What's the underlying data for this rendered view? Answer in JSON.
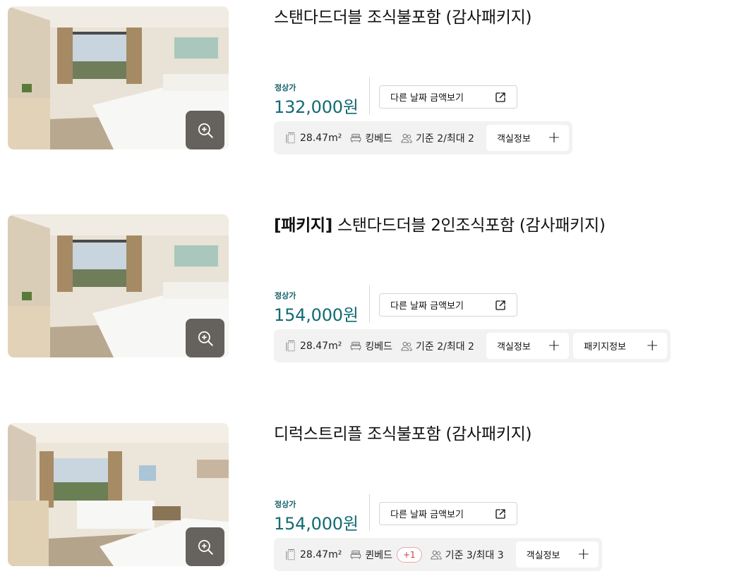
{
  "rooms": [
    {
      "title_tag": "",
      "title": "스탠다드더블 조식불포함 (감사패키지)",
      "price_label": "정상가",
      "price": "132,000원",
      "other_date_label": "다른 날짜 금액보기",
      "area": "28.47m²",
      "bed": "킹베드",
      "bed_badge": "",
      "occupancy": "기준 2/최대 2",
      "room_info_label": "객실정보",
      "package_info_label": ""
    },
    {
      "title_tag": "[패키지]",
      "title": " 스탠다드더블 2인조식포함 (감사패키지)",
      "price_label": "정상가",
      "price": "154,000원",
      "other_date_label": "다른 날짜 금액보기",
      "area": "28.47m²",
      "bed": "킹베드",
      "bed_badge": "",
      "occupancy": "기준 2/최대 2",
      "room_info_label": "객실정보",
      "package_info_label": "패키지정보"
    },
    {
      "title_tag": "",
      "title": "디럭스트리플 조식불포함 (감사패키지)",
      "price_label": "정상가",
      "price": "154,000원",
      "other_date_label": "다른 날짜 금액보기",
      "area": "28.47m²",
      "bed": "퀸베드",
      "bed_badge": "+1",
      "occupancy": "기준 3/최대 3",
      "room_info_label": "객실정보",
      "package_info_label": ""
    }
  ],
  "icons": {
    "zoom": "zoom-in-icon",
    "external": "external-link-icon",
    "area": "area-icon",
    "bed": "bed-icon",
    "people": "people-icon",
    "plus": "plus-icon"
  },
  "colors": {
    "price": "#136a73",
    "badge": "#d93a3a",
    "bar_bg": "#f2f2f2"
  }
}
